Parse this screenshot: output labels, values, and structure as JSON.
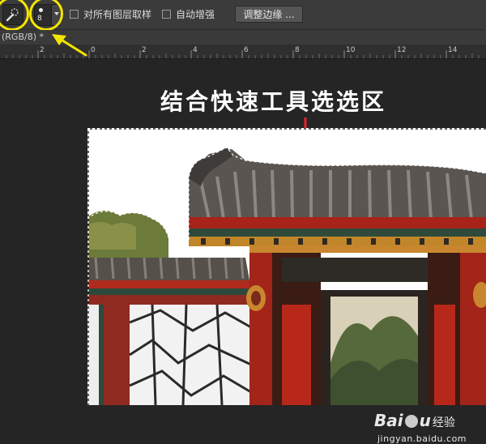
{
  "optionbar": {
    "tool_icon": "quick-selection-brush-icon",
    "brush_size": "8",
    "checkbox_all_layers_label": "对所有图层取样",
    "checkbox_auto_enhance_label": "自动增强",
    "refine_edge_label": "调整边缘 ..."
  },
  "document": {
    "tab_label": "(RGB/8) *"
  },
  "ruler": {
    "labels": [
      "2",
      "0",
      "2",
      "4",
      "6",
      "8",
      "10",
      "12",
      "14"
    ]
  },
  "canvas": {
    "caption": "结合快速工具选选区"
  },
  "watermark": {
    "logo": "Bai",
    "logo_suffix": "u",
    "brand": "经验",
    "url": "jingyan.baidu.com"
  },
  "colors": {
    "highlight_yellow": "#f4e500",
    "arrow_red": "#e8242c",
    "panel_bg": "#3b3b3b",
    "canvas_bg": "#252525"
  }
}
